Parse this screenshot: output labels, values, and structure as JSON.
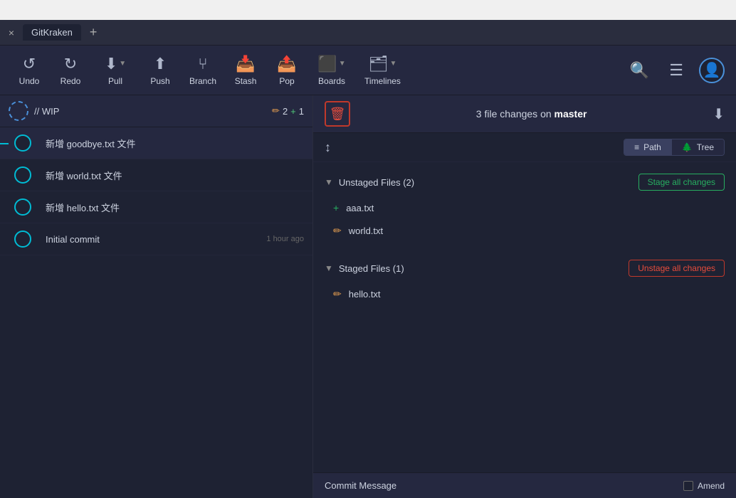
{
  "titleBar": {
    "text": ""
  },
  "tabs": {
    "closeLabel": "×",
    "addLabel": "+",
    "items": [
      {
        "label": "GitKraken"
      }
    ]
  },
  "toolbar": {
    "undo": "Undo",
    "redo": "Redo",
    "pull": "Pull",
    "push": "Push",
    "branch": "Branch",
    "stash": "Stash",
    "pop": "Pop",
    "boards": "Boards",
    "timelines": "Timelines"
  },
  "wip": {
    "label": "// WIP",
    "pencilCount": "2",
    "plusCount": "1"
  },
  "commits": [
    {
      "message": "新增 goodbye.txt 文件",
      "time": "",
      "active": true
    },
    {
      "message": "新增 world.txt 文件",
      "time": "",
      "active": false
    },
    {
      "message": "新增 hello.txt 文件",
      "time": "",
      "active": false
    },
    {
      "message": "Initial commit",
      "time": "1 hour ago",
      "active": false
    }
  ],
  "rightHeader": {
    "changesText": "3 file changes on",
    "branchName": "master"
  },
  "viewToggle": {
    "pathLabel": "≡ Path",
    "treeLabel": "🌲 Tree"
  },
  "unstagedSection": {
    "title": "Unstaged Files (2)",
    "stageBtn": "Stage all changes",
    "files": [
      {
        "name": "aaa.txt",
        "icon": "plus"
      },
      {
        "name": "world.txt",
        "icon": "pencil"
      }
    ]
  },
  "stagedSection": {
    "title": "Staged Files (1)",
    "unstageBtn": "Unstage all changes",
    "files": [
      {
        "name": "hello.txt",
        "icon": "pencil"
      }
    ]
  },
  "commitBar": {
    "label": "Commit Message",
    "amendLabel": "Amend"
  }
}
